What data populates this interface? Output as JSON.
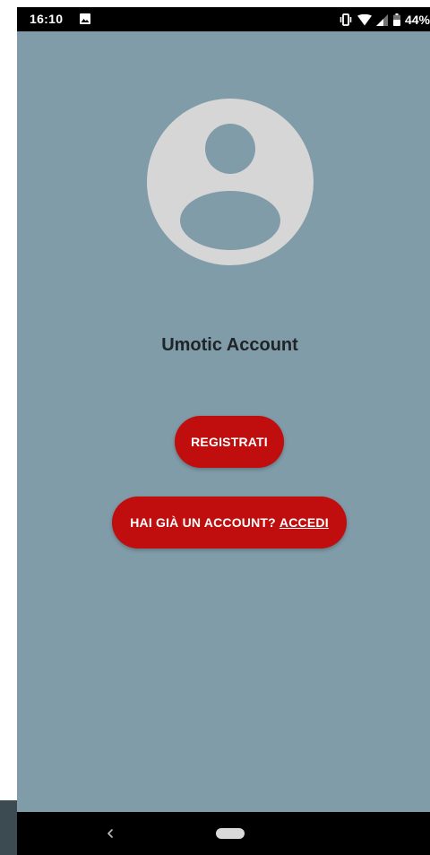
{
  "status_bar": {
    "time": "16:10",
    "battery_percent": "44%",
    "icons": [
      "image-icon",
      "vibrate-icon",
      "wifi-icon",
      "signal-icon",
      "battery-icon"
    ]
  },
  "profile": {
    "avatar_icon": "account-circle-icon",
    "title": "Umotic Account"
  },
  "actions": {
    "register_label": "REGISTRATI",
    "login_prompt": "HAI GIÀ UN ACCOUNT?",
    "login_link": "ACCEDI"
  },
  "nav_bar": {
    "icons": [
      "back-icon",
      "home-pill-icon"
    ]
  },
  "colors": {
    "background": "#809ca9",
    "accent": "#c00d0e",
    "avatar": "#d6d6d6"
  }
}
